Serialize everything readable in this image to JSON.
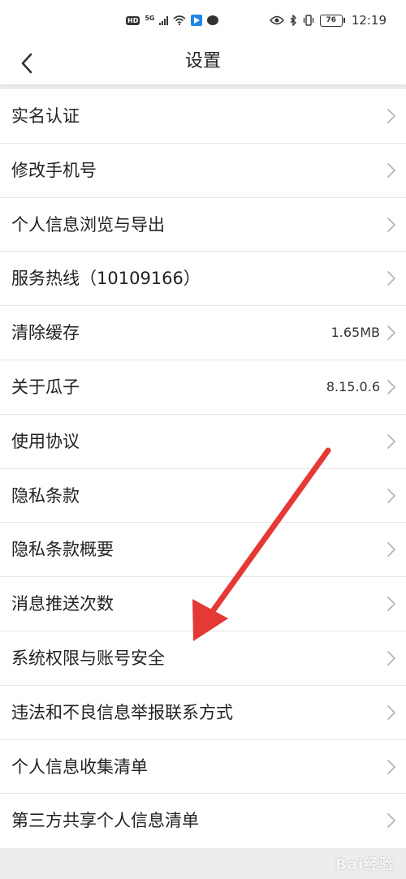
{
  "status_bar": {
    "left_badge": "HD",
    "network": "5G",
    "battery": "76",
    "time": "12:19"
  },
  "header": {
    "title": "设置",
    "back_icon": "chevron-left-icon"
  },
  "settings_items": [
    {
      "label": "实名认证",
      "value": ""
    },
    {
      "label": "修改手机号",
      "value": ""
    },
    {
      "label": "个人信息浏览与导出",
      "value": ""
    },
    {
      "label": "服务热线（10109166）",
      "value": ""
    },
    {
      "label": "清除缓存",
      "value": "1.65MB"
    },
    {
      "label": "关于瓜子",
      "value": "8.15.0.6"
    },
    {
      "label": "使用协议",
      "value": ""
    },
    {
      "label": "隐私条款",
      "value": ""
    },
    {
      "label": "隐私条款概要",
      "value": ""
    },
    {
      "label": "消息推送次数",
      "value": ""
    },
    {
      "label": "系统权限与账号安全",
      "value": ""
    },
    {
      "label": "违法和不良信息举报联系方式",
      "value": ""
    },
    {
      "label": "个人信息收集清单",
      "value": ""
    },
    {
      "label": "第三方共享个人信息清单",
      "value": ""
    }
  ],
  "annotation": {
    "color": "#e53935"
  },
  "watermark": {
    "text": "Bai经验"
  }
}
